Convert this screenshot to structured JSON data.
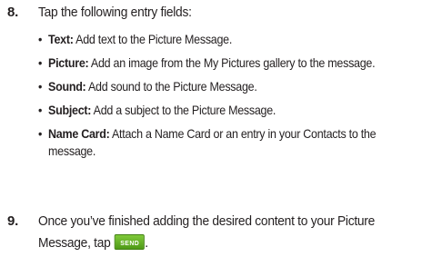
{
  "steps": [
    {
      "number": "8.",
      "text": "Tap the following entry fields:",
      "bullets": [
        {
          "term": "Text",
          "separator": ":",
          "description": " Add text to the Picture Message."
        },
        {
          "term": "Picture",
          "separator": ":",
          "description": " Add an image from the My Pictures gallery to the message."
        },
        {
          "term": "Sound:",
          "separator": "",
          "description": " Add sound to the Picture Message."
        },
        {
          "term": "Subject",
          "separator": ":",
          "description": " Add a subject to the Picture Message."
        },
        {
          "term": "Name Card",
          "separator": ":",
          "description": " Attach a Name Card or an entry in your Contacts to the message."
        }
      ]
    },
    {
      "number": "9.",
      "text_before": "Once you’ve finished adding the desired content to your Picture Message, tap",
      "button_label": "SEND",
      "text_after": "."
    }
  ],
  "bullet_glyph": "•",
  "colors": {
    "text": "#231f20",
    "send_button": "#62b021"
  }
}
